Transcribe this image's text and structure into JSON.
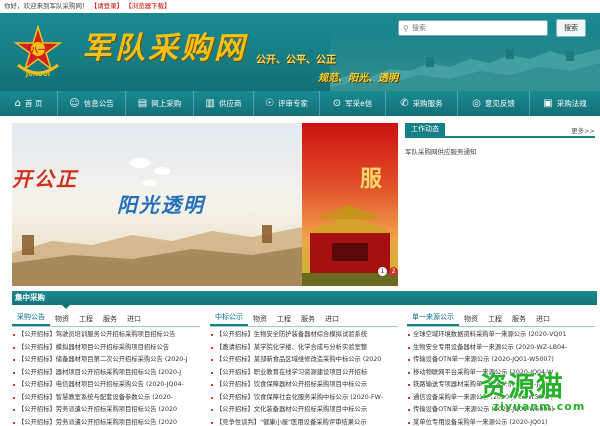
{
  "topbar": {
    "welcome": "你好，欢迎来到军队采购网！",
    "login": "【请登录】",
    "browser_download": "【浏览器下载】"
  },
  "header": {
    "site_title": "军队采购网",
    "slogan_line1": "公开、公平、公正",
    "slogan_line2": "规范、阳光、透明",
    "search_placeholder": "搜索",
    "search_button": "搜索",
    "emblem_text": "JUNDUI",
    "colors": {
      "teal": "#177f86",
      "gold": "#f2c21a"
    }
  },
  "nav": [
    {
      "label": "首 页",
      "icon": "home-icon",
      "glyph": "⌂"
    },
    {
      "label": "信息公告",
      "icon": "chat-icon",
      "glyph": "☺"
    },
    {
      "label": "网上采购",
      "icon": "cart-icon",
      "glyph": "▤"
    },
    {
      "label": "供应商",
      "icon": "store-icon",
      "glyph": "▥"
    },
    {
      "label": "评审专家",
      "icon": "user-icon",
      "glyph": "☉"
    },
    {
      "label": "军采e信",
      "icon": "search-icon",
      "glyph": "⊙"
    },
    {
      "label": "采购服务",
      "icon": "phone-icon",
      "glyph": "✆"
    },
    {
      "label": "意见反馈",
      "icon": "feedback-icon",
      "glyph": "◎"
    },
    {
      "label": "采购法规",
      "icon": "book-icon",
      "glyph": "▣"
    }
  ],
  "banner": {
    "text1": "开公正",
    "text2": "阳光透明",
    "text3": "服",
    "dots": [
      "1",
      "2"
    ]
  },
  "work": {
    "title": "工作动态",
    "more": "更多>>",
    "items": [
      "军队采购网供应服务通知"
    ]
  },
  "section": {
    "title": "集中采购"
  },
  "columns": [
    {
      "tabs": [
        "采购公告",
        "物资",
        "工程",
        "服务",
        "进口"
      ],
      "items": [
        "【公开招标】驾驶员培训服务公开招标采购项目招标公告",
        "【公开招标】模拟器材项目公开招标采购项目招标公告",
        "【公开招标】储备器材项目第二次公开招标采购公告 (2020-J",
        "【公开招标】器材项目公开招标采购项目招标公告 (2020-J",
        "【公开招标】电信器材项目公开招标采购公告 (2020-JQ04-",
        "【公开招标】智慧教室系统与配套设备参数公示 (2020-",
        "【公开招标】劳务派遣公开招标采购项目招标公告 (2020",
        "【公开招标】劳务派遣公开招标采购项目招标公告 (2020"
      ]
    },
    {
      "tabs": [
        "中标公示",
        "物资",
        "工程",
        "服务",
        "进口"
      ],
      "items": [
        "【公开招标】生物安全防护装备器材综合模拟试验系统",
        "【邀请招标】某学院化学楼、化学合成与分析实验室整",
        "【公开招标】某部新食品区域维修改造采购中标公示 (2020",
        "【公开招标】职业教育在线学习资源建设项目公开招标",
        "【公开招标】饮食保障器材公开招标采购项目中标公示",
        "【公开招标】饮食保障社会化服务采购中标公示 (2020-FW-",
        "【公开招标】文化装备器材公开招标采购项目中标公示",
        "【竞争性谈判】\"健康小屋\"医用设备采购评审结果公示"
      ]
    },
    {
      "tabs": [
        "单一来源公示",
        "物资",
        "工程",
        "服务",
        "进口"
      ],
      "items": [
        "全球空域环境数据资料采购单一来源公示 (2020-VQ01",
        "生物安全专用设备器材单一来源公示 (2020-WZ-LB04-",
        "传输设备OTN单一来源公示 (2020-JQ01-W5007)",
        "移动物联网平台采购单一来源公示 (2020-JQ04-W",
        "铁路输送专项器材采购单一来源公示 (2020-JQ01-",
        "通信设备采购单一来源公示 (2020-JQ05-W5006)",
        "传输设备OTN单一来源公示 (2020-JQ01-W5006)",
        "某单位专用设备采购单一来源公示 (2020-JQ01)"
      ]
    }
  ],
  "watermark": {
    "logo": "资源猫",
    "url": "ziyuanm.com"
  }
}
